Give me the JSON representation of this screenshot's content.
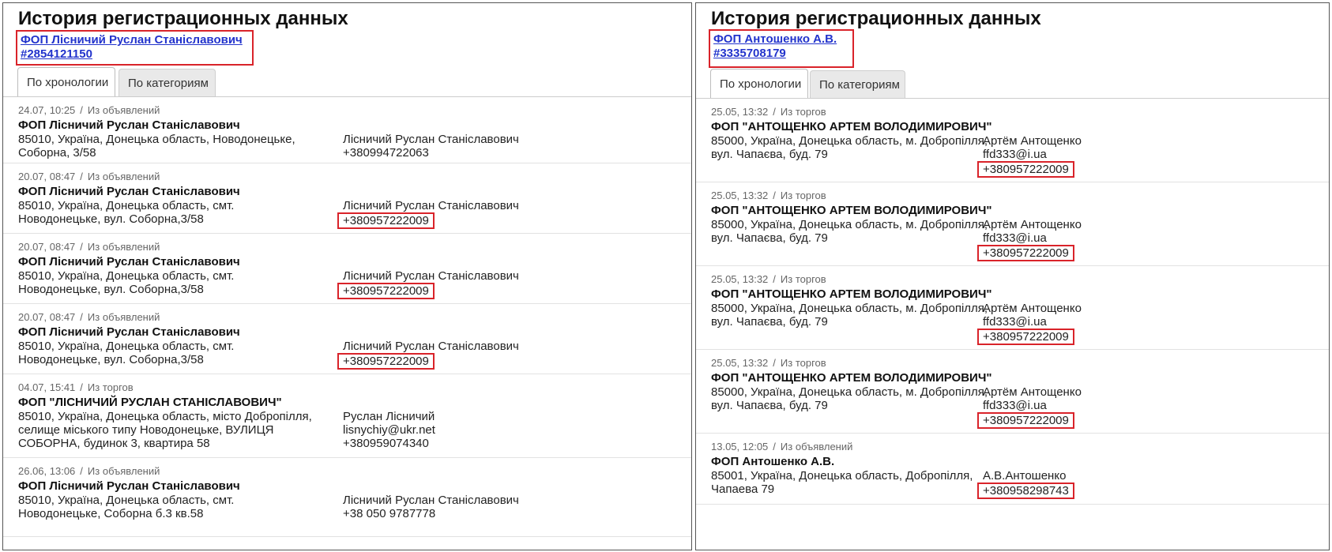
{
  "panels": [
    {
      "title": "История регистрационных данных",
      "entity_name": "ФОП Лісничий Руслан Станіславович",
      "entity_id": "#2854121150",
      "tabs": [
        {
          "label": "По хронологии",
          "active": true
        },
        {
          "label": "По категориям",
          "active": false
        }
      ],
      "entries": [
        {
          "date": "24.07, 10:25",
          "source": "Из объявлений",
          "name": "ФОП Лісничий Руслан Станіславович",
          "address": "85010, Україна, Донецька область, Новодонецьке,\nСоборна, 3/58",
          "contact": [
            "Лісничий Руслан Станіславович",
            "+380994722063"
          ],
          "highlight": []
        },
        {
          "date": "20.07, 08:47",
          "source": "Из объявлений",
          "name": "ФОП Лісничий Руслан Станіславович",
          "address": "85010, Україна, Донецька область, смт.\nНоводонецьке, вул. Соборна,3/58",
          "contact": [
            "Лісничий Руслан Станіславович",
            "+380957222009"
          ],
          "highlight": [
            1
          ]
        },
        {
          "date": "20.07, 08:47",
          "source": "Из объявлений",
          "name": "ФОП Лісничий Руслан Станіславович",
          "address": "85010, Україна, Донецька область, смт.\nНоводонецьке, вул. Соборна,3/58",
          "contact": [
            "Лісничий Руслан Станіславович",
            "+380957222009"
          ],
          "highlight": [
            1
          ]
        },
        {
          "date": "20.07, 08:47",
          "source": "Из объявлений",
          "name": "ФОП Лісничий Руслан Станіславович",
          "address": "85010, Україна, Донецька область, смт.\nНоводонецьке, вул. Соборна,3/58",
          "contact": [
            "Лісничий Руслан Станіславович",
            "+380957222009"
          ],
          "highlight": [
            1
          ]
        },
        {
          "date": "04.07, 15:41",
          "source": "Из торгов",
          "name": "ФОП \"ЛІСНИЧИЙ РУСЛАН СТАНІСЛАВОВИЧ\"",
          "address": "85010, Україна, Донецька область, місто Добропілля,\nселище міського типу Новодонецьке, ВУЛИЦЯ\nСОБОРНА, будинок 3, квартира 58",
          "contact": [
            "Руслан Лісничий",
            "lisnychiy@ukr.net",
            "+380959074340"
          ],
          "highlight": []
        },
        {
          "date": "26.06, 13:06",
          "source": "Из объявлений",
          "name": "ФОП Лісничий Руслан Станіславович",
          "address": "85010, Україна, Донецька область, смт.\nНоводонецьке, Соборна б.3 кв.58",
          "contact": [
            "Лісничий Руслан Станіславович",
            "+38 050 9787778"
          ],
          "highlight": []
        }
      ]
    },
    {
      "title": "История регистрационных данных",
      "entity_name": "ФОП Антошенко А.В.",
      "entity_id": "#3335708179",
      "tabs": [
        {
          "label": "По хронологии",
          "active": true
        },
        {
          "label": "По категориям",
          "active": false
        }
      ],
      "entries": [
        {
          "date": "25.05, 13:32",
          "source": "Из торгов",
          "name": "ФОП \"АНТОЩЕНКО АРТЕМ ВОЛОДИМИРОВИЧ\"",
          "address": "85000, Україна, Донецька область, м. Добропілля,\nвул. Чапаєва, буд. 79",
          "contact": [
            "Артём Антощенко",
            "ffd333@i.ua",
            "+380957222009"
          ],
          "highlight": [
            2
          ]
        },
        {
          "date": "25.05, 13:32",
          "source": "Из торгов",
          "name": "ФОП \"АНТОЩЕНКО АРТЕМ ВОЛОДИМИРОВИЧ\"",
          "address": "85000, Україна, Донецька область, м. Добропілля,\nвул. Чапаєва, буд. 79",
          "contact": [
            "Артём Антощенко",
            "ffd333@i.ua",
            "+380957222009"
          ],
          "highlight": [
            2
          ]
        },
        {
          "date": "25.05, 13:32",
          "source": "Из торгов",
          "name": "ФОП \"АНТОЩЕНКО АРТЕМ ВОЛОДИМИРОВИЧ\"",
          "address": "85000, Україна, Донецька область, м. Добропілля,\nвул. Чапаєва, буд. 79",
          "contact": [
            "Артём Антощенко",
            "ffd333@i.ua",
            "+380957222009"
          ],
          "highlight": [
            2
          ]
        },
        {
          "date": "25.05, 13:32",
          "source": "Из торгов",
          "name": "ФОП \"АНТОЩЕНКО АРТЕМ ВОЛОДИМИРОВИЧ\"",
          "address": "85000, Україна, Донецька область, м. Добропілля,\nвул. Чапаєва, буд. 79",
          "contact": [
            "Артём Антощенко",
            "ffd333@i.ua",
            "+380957222009"
          ],
          "highlight": [
            2
          ]
        },
        {
          "date": "13.05, 12:05",
          "source": "Из объявлений",
          "name": "ФОП Антошенко А.В.",
          "address": "85001, Україна, Донецька область, Добропілля,\nЧапаева 79",
          "contact": [
            "А.В.Антошенко",
            "+380958298743"
          ],
          "highlight": [
            1
          ]
        }
      ]
    }
  ],
  "colors": {
    "highlight_border": "#d9232a",
    "link": "#2233cc"
  }
}
